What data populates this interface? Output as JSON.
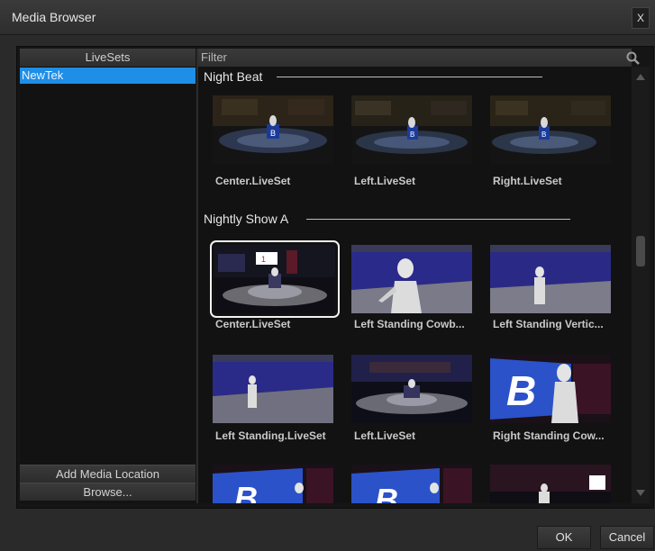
{
  "window": {
    "title": "Media Browser",
    "close_label": "X"
  },
  "left_panel": {
    "header": "LiveSets",
    "items": [
      {
        "label": "NewTek",
        "selected": true
      }
    ],
    "add_location_label": "Add Media Location",
    "browse_label": "Browse..."
  },
  "right_panel": {
    "filter_label": "Filter",
    "sections": [
      {
        "title": "Night Beat",
        "items": [
          {
            "caption": "Center.LiveSet"
          },
          {
            "caption": "Left.LiveSet"
          },
          {
            "caption": "Right.LiveSet"
          }
        ]
      },
      {
        "title": "Nightly Show A",
        "items": [
          {
            "caption": "Center.LiveSet",
            "selected": true
          },
          {
            "caption": "Left Standing Cowb..."
          },
          {
            "caption": "Left Standing Vertic..."
          },
          {
            "caption": "Left Standing.LiveSet"
          },
          {
            "caption": "Left.LiveSet"
          },
          {
            "caption": "Right Standing Cow..."
          }
        ]
      }
    ]
  },
  "footer": {
    "ok_label": "OK",
    "cancel_label": "Cancel"
  },
  "colors": {
    "selection": "#1e8ee6",
    "background": "#2a2a2a",
    "panel": "#121212"
  },
  "icons": {
    "search": "search-icon",
    "close": "close-icon"
  }
}
